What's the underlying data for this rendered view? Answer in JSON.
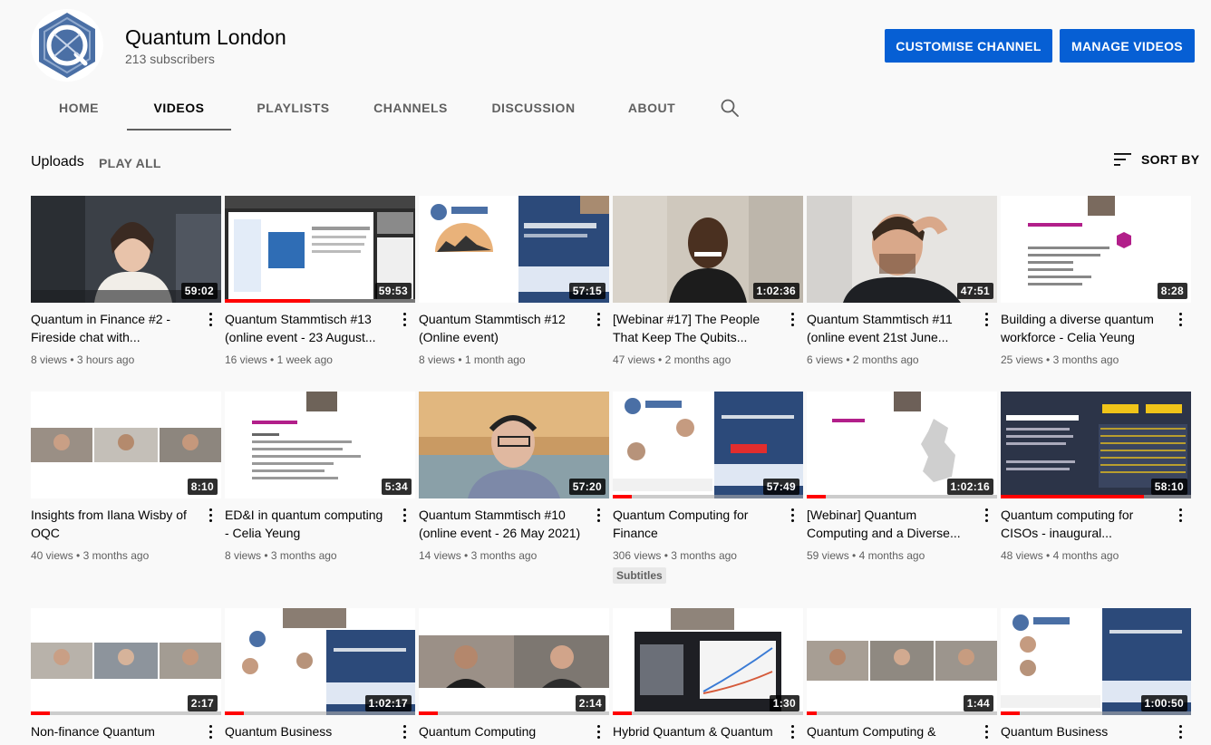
{
  "channel": {
    "name": "Quantum London",
    "subscribers": "213 subscribers",
    "customise_label": "CUSTOMISE CHANNEL",
    "manage_label": "MANAGE VIDEOS"
  },
  "tabs": [
    "HOME",
    "VIDEOS",
    "PLAYLISTS",
    "CHANNELS",
    "DISCUSSION",
    "ABOUT"
  ],
  "active_tab": "VIDEOS",
  "section": {
    "label": "Uploads",
    "play_all": "PLAY ALL",
    "sort_label": "SORT BY"
  },
  "colors": {
    "accent": "#065fd4",
    "progress": "#ff0000",
    "brand": "#4a6fa5"
  },
  "videos": [
    {
      "title": "Quantum in Finance #2 - Fireside chat with...",
      "duration": "59:02",
      "views": "8 views",
      "age": "3 hours ago",
      "progress": 0
    },
    {
      "title": "Quantum Stammtisch #13 (online event - 23 August...",
      "duration": "59:53",
      "views": "16 views",
      "age": "1 week ago",
      "progress": 0.45
    },
    {
      "title": "Quantum Stammtisch #12 (Online event)",
      "duration": "57:15",
      "views": "8 views",
      "age": "1 month ago",
      "progress": 0
    },
    {
      "title": "[Webinar #17] The People That Keep The Qubits...",
      "duration": "1:02:36",
      "views": "47 views",
      "age": "2 months ago",
      "progress": 0
    },
    {
      "title": "Quantum Stammtisch #11 (online event 21st June...",
      "duration": "47:51",
      "views": "6 views",
      "age": "2 months ago",
      "progress": 0
    },
    {
      "title": "Building a diverse quantum workforce - Celia Yeung",
      "duration": "8:28",
      "views": "25 views",
      "age": "3 months ago",
      "progress": 0
    },
    {
      "title": "Insights from Ilana Wisby of OQC",
      "duration": "8:10",
      "views": "40 views",
      "age": "3 months ago",
      "progress": 0
    },
    {
      "title": "ED&I in quantum computing - Celia Yeung",
      "duration": "5:34",
      "views": "8 views",
      "age": "3 months ago",
      "progress": 0
    },
    {
      "title": "Quantum Stammtisch #10 (online event - 26 May 2021)",
      "duration": "57:20",
      "views": "14 views",
      "age": "3 months ago",
      "progress": 0
    },
    {
      "title": "Quantum Computing for Finance",
      "duration": "57:49",
      "views": "306 views",
      "age": "3 months ago",
      "progress": 0.1,
      "badge": "Subtitles"
    },
    {
      "title": "[Webinar] Quantum Computing and a Diverse...",
      "duration": "1:02:16",
      "views": "59 views",
      "age": "4 months ago",
      "progress": 0.1
    },
    {
      "title": "Quantum computing for CISOs - inaugural...",
      "duration": "58:10",
      "views": "48 views",
      "age": "4 months ago",
      "progress": 0.75
    },
    {
      "title": "Non-finance Quantum",
      "duration": "2:17",
      "views": "",
      "age": "",
      "progress": 0.1
    },
    {
      "title": "Quantum Business",
      "duration": "1:02:17",
      "views": "",
      "age": "",
      "progress": 0.1
    },
    {
      "title": "Quantum Computing",
      "duration": "2:14",
      "views": "",
      "age": "",
      "progress": 0.1
    },
    {
      "title": "Hybrid Quantum & Quantum",
      "duration": "1:30",
      "views": "",
      "age": "",
      "progress": 0.1
    },
    {
      "title": "Quantum Computing &",
      "duration": "1:44",
      "views": "",
      "age": "",
      "progress": 0.05
    },
    {
      "title": "Quantum Business",
      "duration": "1:00:50",
      "views": "",
      "age": "",
      "progress": 0.1
    }
  ]
}
